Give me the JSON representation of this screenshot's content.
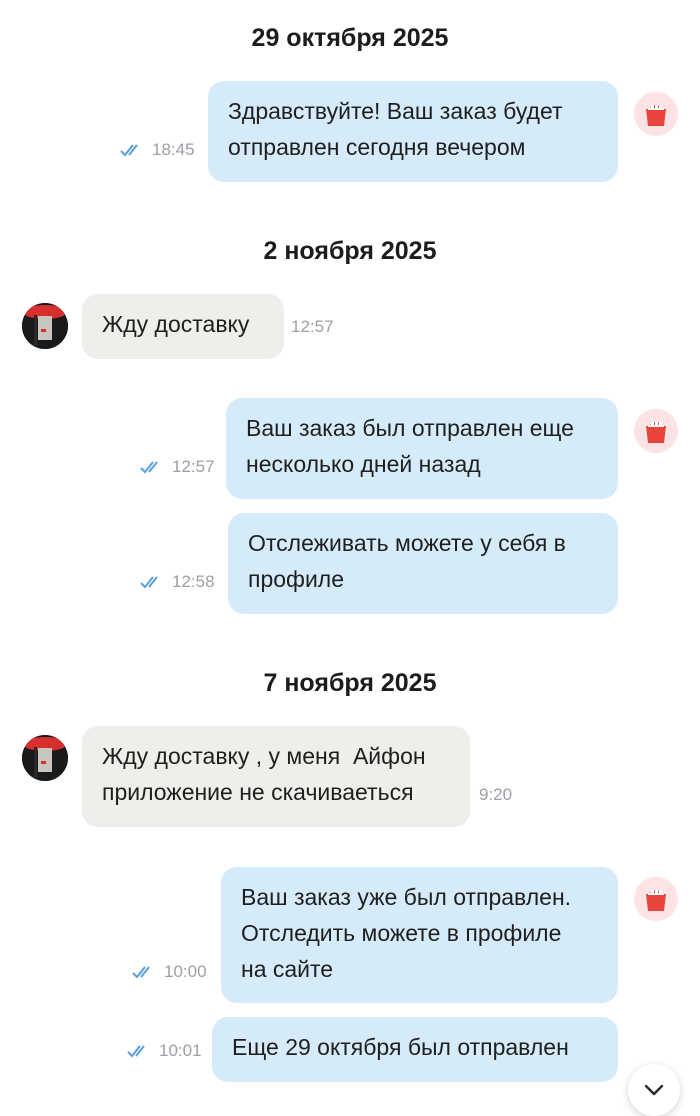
{
  "days": [
    {
      "date": "29 октября 2025",
      "messages": [
        {
          "direction": "out",
          "lines": [
            "Здравствуйте! Ваш заказ будет",
            "отправлен сегодня вечером"
          ],
          "time": "18:45",
          "status": "read"
        }
      ]
    },
    {
      "date": "2 ноября 2025",
      "messages": [
        {
          "direction": "in",
          "lines": [
            "Жду доставку"
          ],
          "time": "12:57"
        },
        {
          "direction": "out",
          "lines": [
            "Ваш заказ был отправлен еще",
            "несколько дней назад"
          ],
          "time": "12:57",
          "status": "read"
        },
        {
          "direction": "out",
          "lines": [
            "Отслеживать можете у себя в",
            "профиле"
          ],
          "time": "12:58",
          "status": "read"
        }
      ]
    },
    {
      "date": "7 ноября 2025",
      "messages": [
        {
          "direction": "in",
          "lines": [
            "Жду доставку , у меня  Айфон",
            "приложение не скачиваеться"
          ],
          "time": "9:20"
        },
        {
          "direction": "out",
          "lines": [
            "Ваш заказ уже был отправлен.",
            "Отследить можете в профиле",
            "на сайте"
          ],
          "time": "10:00",
          "status": "read"
        },
        {
          "direction": "out",
          "lines": [
            "Еще 29 октября был отправлен"
          ],
          "time": "10:01",
          "status": "read"
        }
      ]
    }
  ],
  "icons": {
    "read_status": "double-check-icon",
    "shop_avatar": "shop-bag-avatar-icon",
    "user_avatar": "user-avatar",
    "scroll_down": "chevron-down-icon"
  },
  "colors": {
    "outgoing_bubble": "#d6ebfa",
    "incoming_bubble": "#efeeea",
    "read_ticks": "#5a9fdc",
    "shop_accent": "#e8463c"
  }
}
